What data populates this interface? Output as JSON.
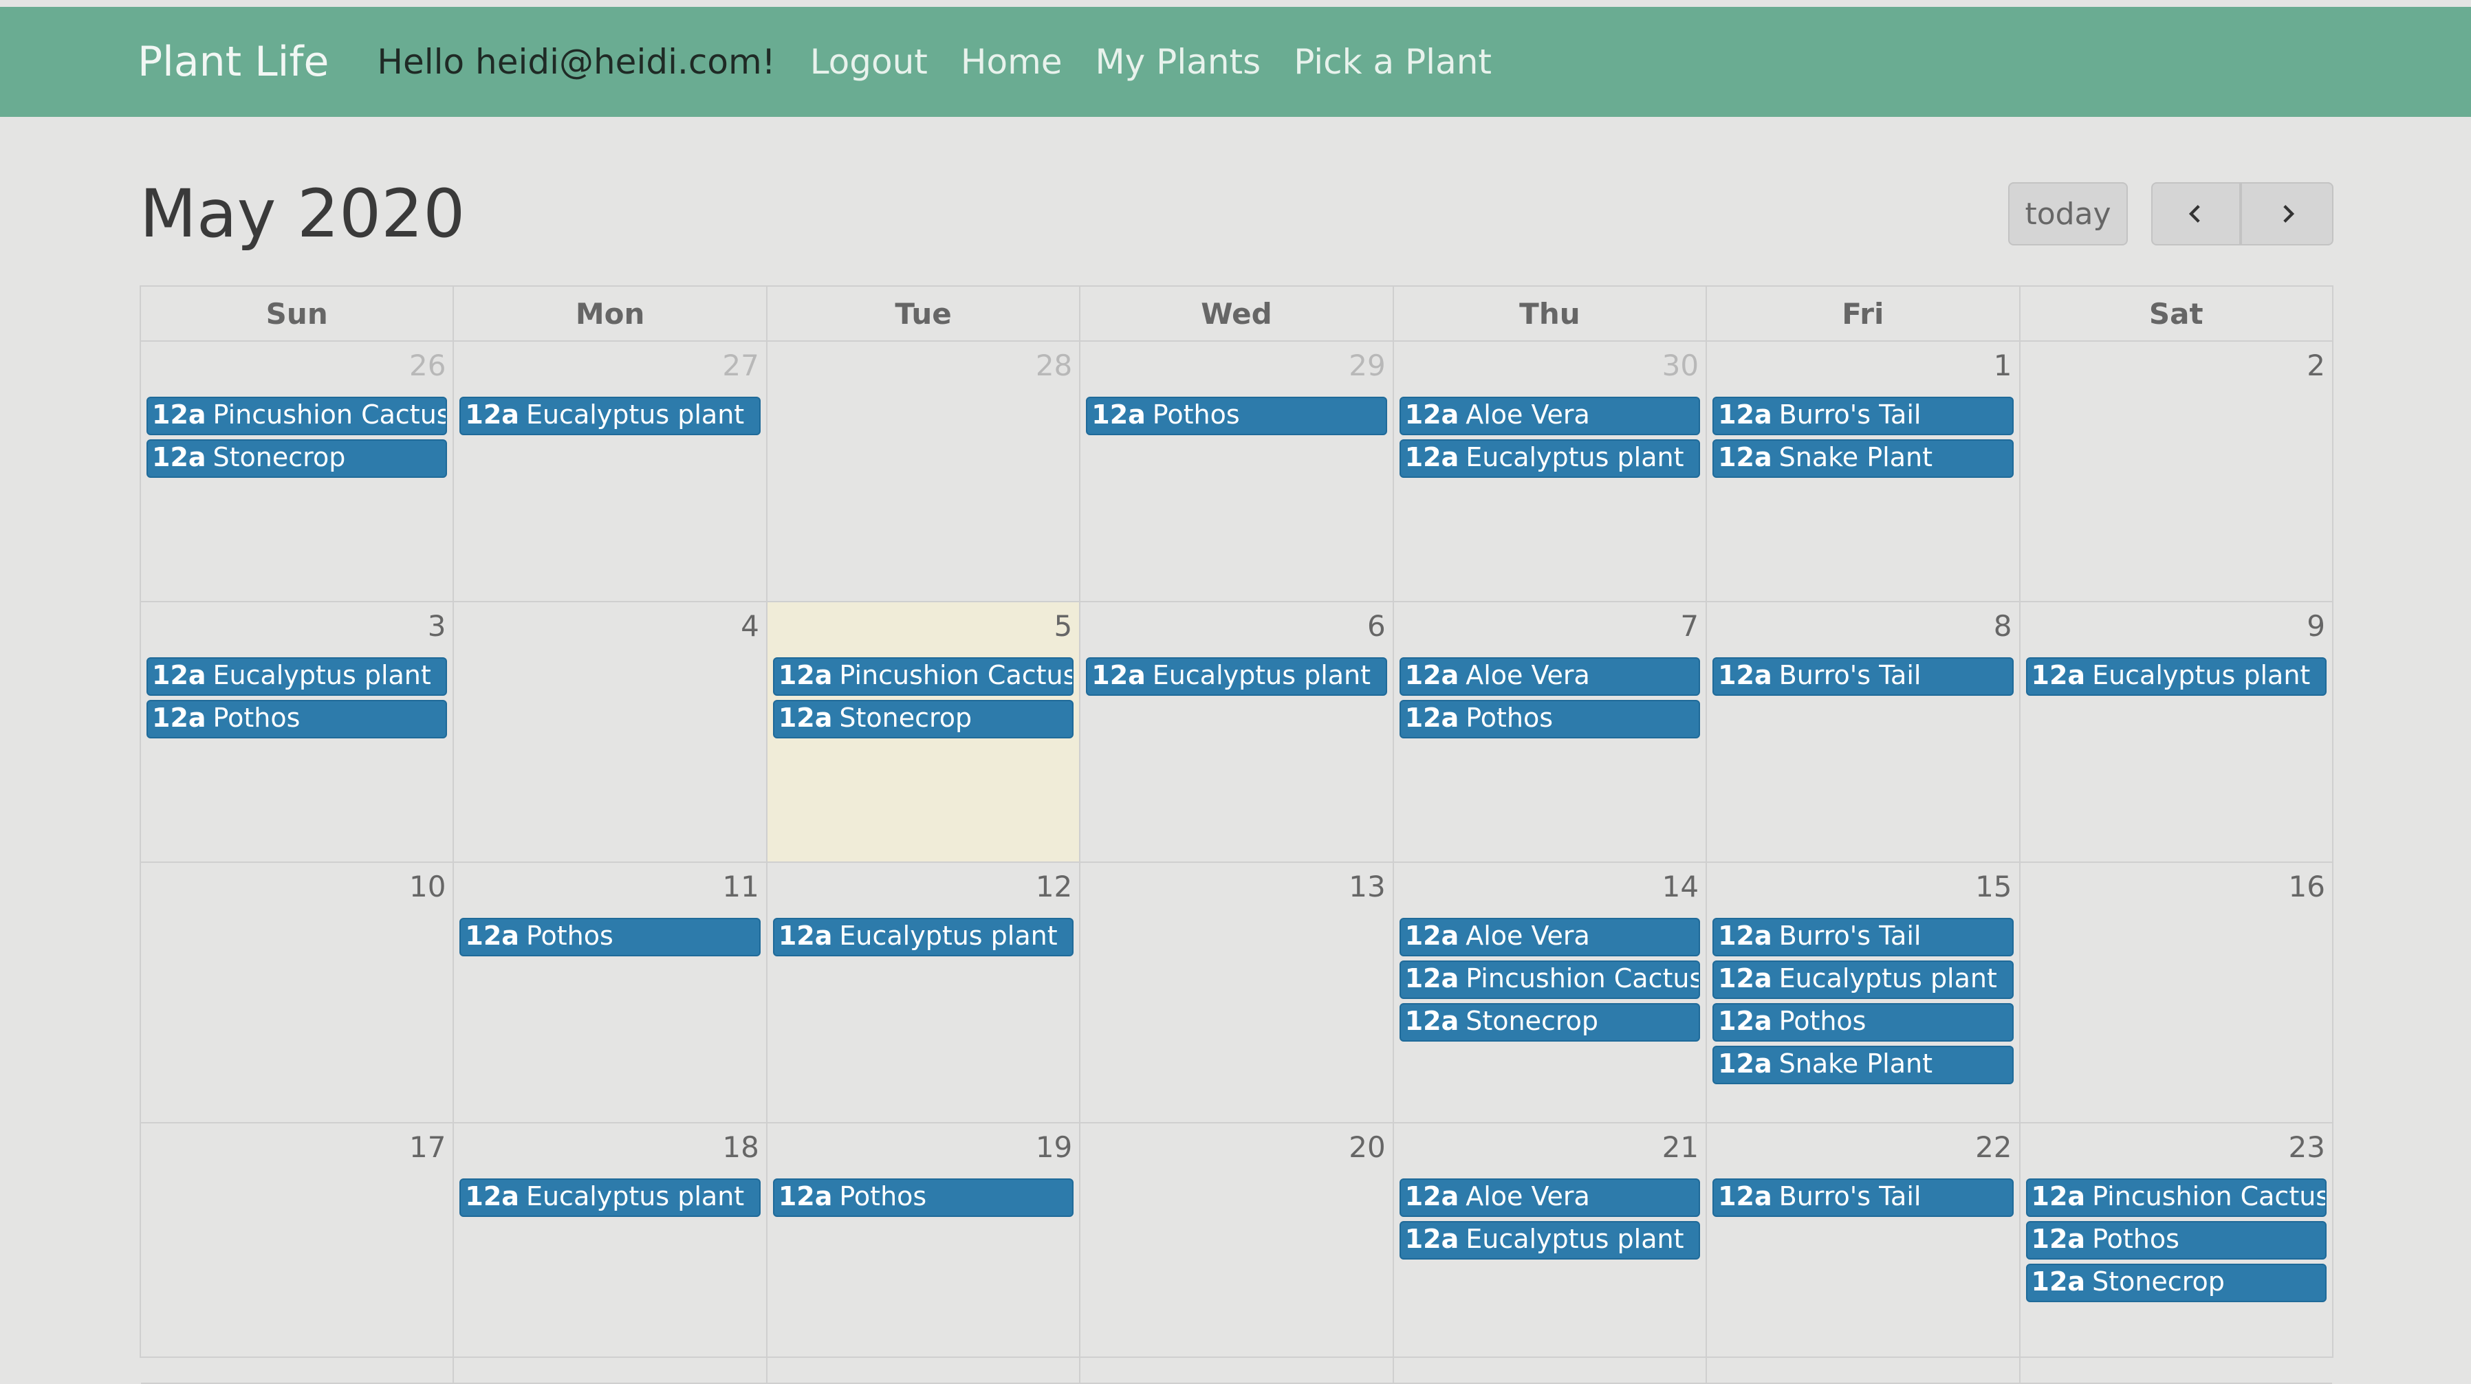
{
  "nav": {
    "brand": "Plant Life",
    "greeting": "Hello heidi@heidi.com!",
    "links": [
      "Logout",
      "Home",
      "My Plants",
      "Pick a Plant"
    ]
  },
  "calendar": {
    "title": "May 2020",
    "today_label": "today",
    "prev_icon": "chevron-left-icon",
    "next_icon": "chevron-right-icon",
    "weekdays": [
      "Sun",
      "Mon",
      "Tue",
      "Wed",
      "Thu",
      "Fri",
      "Sat"
    ],
    "weeks": [
      [
        {
          "day": "26",
          "other": true,
          "events": [
            "Pincushion Cactus",
            "Stonecrop"
          ]
        },
        {
          "day": "27",
          "other": true,
          "events": [
            "Eucalyptus plant"
          ]
        },
        {
          "day": "28",
          "other": true,
          "events": []
        },
        {
          "day": "29",
          "other": true,
          "events": [
            "Pothos"
          ]
        },
        {
          "day": "30",
          "other": true,
          "events": [
            "Aloe Vera",
            "Eucalyptus plant"
          ]
        },
        {
          "day": "1",
          "events": [
            "Burro's Tail",
            "Snake Plant"
          ]
        },
        {
          "day": "2",
          "events": []
        }
      ],
      [
        {
          "day": "3",
          "events": [
            "Eucalyptus plant",
            "Pothos"
          ]
        },
        {
          "day": "4",
          "events": []
        },
        {
          "day": "5",
          "today": true,
          "events": [
            "Pincushion Cactus",
            "Stonecrop"
          ]
        },
        {
          "day": "6",
          "events": [
            "Eucalyptus plant"
          ]
        },
        {
          "day": "7",
          "events": [
            "Aloe Vera",
            "Pothos"
          ]
        },
        {
          "day": "8",
          "events": [
            "Burro's Tail"
          ]
        },
        {
          "day": "9",
          "events": [
            "Eucalyptus plant"
          ]
        }
      ],
      [
        {
          "day": "10",
          "events": []
        },
        {
          "day": "11",
          "events": [
            "Pothos"
          ]
        },
        {
          "day": "12",
          "events": [
            "Eucalyptus plant"
          ]
        },
        {
          "day": "13",
          "events": []
        },
        {
          "day": "14",
          "events": [
            "Aloe Vera",
            "Pincushion Cactus",
            "Stonecrop"
          ]
        },
        {
          "day": "15",
          "events": [
            "Burro's Tail",
            "Eucalyptus plant",
            "Pothos",
            "Snake Plant"
          ]
        },
        {
          "day": "16",
          "events": []
        }
      ],
      [
        {
          "day": "17",
          "events": []
        },
        {
          "day": "18",
          "events": [
            "Eucalyptus plant"
          ]
        },
        {
          "day": "19",
          "events": [
            "Pothos"
          ]
        },
        {
          "day": "20",
          "events": []
        },
        {
          "day": "21",
          "events": [
            "Aloe Vera",
            "Eucalyptus plant"
          ]
        },
        {
          "day": "22",
          "events": [
            "Burro's Tail"
          ]
        },
        {
          "day": "23",
          "events": [
            "Pincushion Cactus",
            "Pothos",
            "Stonecrop"
          ]
        }
      ]
    ],
    "event_time": "12a"
  },
  "colors": {
    "navbar": "#6aac92",
    "event": "#2d7bab",
    "today_cell": "#f0ecd8"
  }
}
